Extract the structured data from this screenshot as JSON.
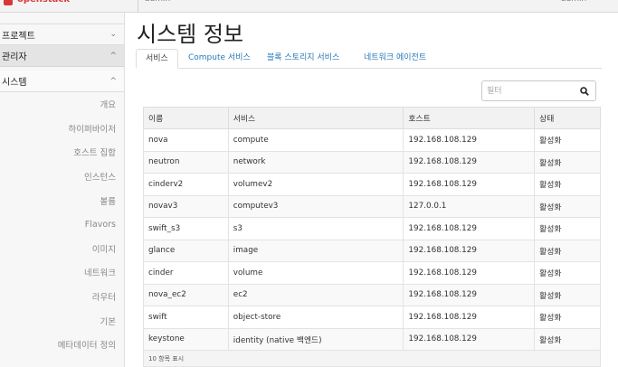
{
  "topbar": {
    "brand": "openstack",
    "project": "admin",
    "user": "admin"
  },
  "sidebar": {
    "project_label": "프로젝트",
    "admin_label": "관리자",
    "system_label": "시스템",
    "items": [
      {
        "label": "개요"
      },
      {
        "label": "하이퍼바이저"
      },
      {
        "label": "호스트 집합"
      },
      {
        "label": "인스턴스"
      },
      {
        "label": "볼륨"
      },
      {
        "label": "Flavors"
      },
      {
        "label": "이미지"
      },
      {
        "label": "네트워크"
      },
      {
        "label": "라우터"
      },
      {
        "label": "기본"
      },
      {
        "label": "메타데이터 정의"
      }
    ]
  },
  "main": {
    "title": "시스템 정보",
    "tabs": [
      {
        "label": "서비스"
      },
      {
        "label": "Compute 서비스"
      },
      {
        "label": "블록 스토리지 서비스"
      },
      {
        "label": "네트워크 에이전트"
      }
    ],
    "filter": {
      "placeholder": "필터"
    },
    "table": {
      "headers": [
        "이름",
        "서비스",
        "호스트",
        "상태"
      ],
      "rows": [
        [
          "nova",
          "compute",
          "192.168.108.129",
          "활성화"
        ],
        [
          "neutron",
          "network",
          "192.168.108.129",
          "활성화"
        ],
        [
          "cinderv2",
          "volumev2",
          "192.168.108.129",
          "활성화"
        ],
        [
          "novav3",
          "computev3",
          "127.0.0.1",
          "활성화"
        ],
        [
          "swift_s3",
          "s3",
          "192.168.108.129",
          "활성화"
        ],
        [
          "glance",
          "image",
          "192.168.108.129",
          "활성화"
        ],
        [
          "cinder",
          "volume",
          "192.168.108.129",
          "활성화"
        ],
        [
          "nova_ec2",
          "ec2",
          "192.168.108.129",
          "활성화"
        ],
        [
          "swift",
          "object-store",
          "192.168.108.129",
          "활성화"
        ],
        [
          "keystone",
          "identity (native 백엔드)",
          "192.168.108.129",
          "활성화"
        ]
      ],
      "footer": "10 항목 표시"
    }
  }
}
